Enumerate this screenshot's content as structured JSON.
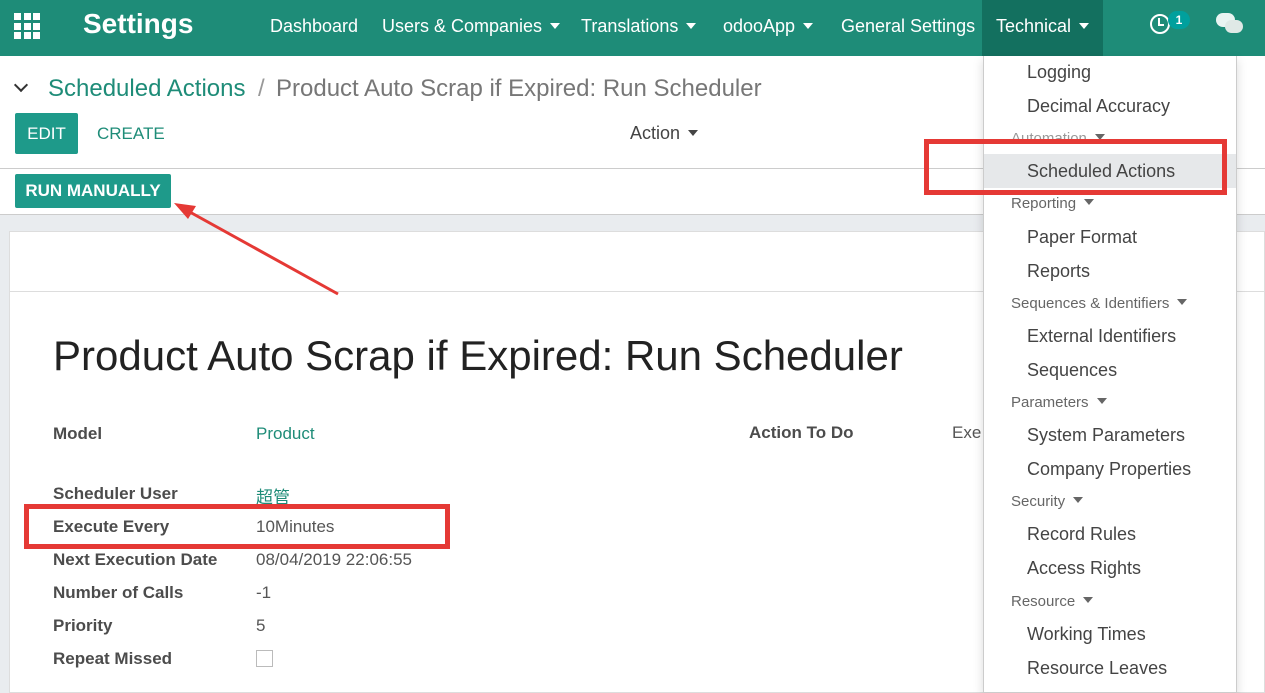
{
  "navbar": {
    "brand": "Settings",
    "items": [
      {
        "label": "Dashboard"
      },
      {
        "label": "Users & Companies"
      },
      {
        "label": "Translations"
      },
      {
        "label": "odooApp"
      },
      {
        "label": "General Settings"
      },
      {
        "label": "Technical"
      }
    ],
    "activity_count": "1",
    "icons": [
      "apps-icon",
      "clock-icon",
      "chat-icon"
    ]
  },
  "breadcrumb": {
    "parent": "Scheduled Actions",
    "separator": "/",
    "current": "Product Auto Scrap if Expired: Run Scheduler"
  },
  "toolbar": {
    "edit_label": "EDIT",
    "create_label": "CREATE",
    "action_label": "Action"
  },
  "statusbar": {
    "run_label": "RUN MANUALLY"
  },
  "form": {
    "title": "Product Auto Scrap if Expired: Run Scheduler",
    "fields": {
      "model": {
        "label": "Model",
        "value": "Product"
      },
      "user": {
        "label": "Scheduler User",
        "value": "超管"
      },
      "interval": {
        "label": "Execute Every",
        "value": "10Minutes"
      },
      "nextcall": {
        "label": "Next Execution Date",
        "value": "08/04/2019 22:06:55"
      },
      "numcall": {
        "label": "Number of Calls",
        "value": "-1"
      },
      "priority": {
        "label": "Priority",
        "value": "5"
      },
      "doall": {
        "label": "Repeat Missed",
        "value": false
      },
      "action": {
        "label": "Action To Do",
        "value": "Exec"
      }
    }
  },
  "dropdown": {
    "logging": "Logging",
    "decimal": "Decimal Accuracy",
    "automation": "Automation",
    "scheduled": "Scheduled Actions",
    "reporting": "Reporting",
    "paper": "Paper Format",
    "reports": "Reports",
    "sequences_header": "Sequences & Identifiers",
    "external": "External Identifiers",
    "sequences": "Sequences",
    "parameters": "Parameters",
    "system": "System Parameters",
    "company": "Company Properties",
    "security": "Security",
    "rules": "Record Rules",
    "access": "Access Rights",
    "resource": "Resource",
    "working": "Working Times",
    "leaves": "Resource Leaves"
  },
  "colors": {
    "navbar": "#1e8c78",
    "primary_button": "#1e9a8a",
    "annotation": "#e53935"
  }
}
